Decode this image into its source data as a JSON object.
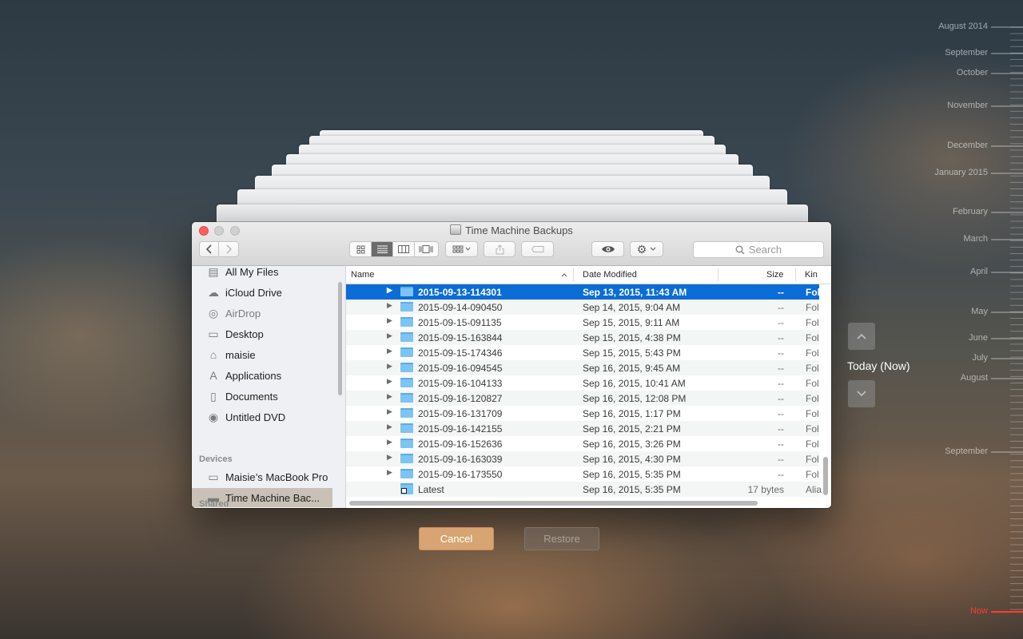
{
  "window": {
    "title": "Time Machine Backups"
  },
  "toolbar": {
    "search_placeholder": "Search",
    "back_icon": "chevron-left-icon",
    "forward_icon": "chevron-right-icon"
  },
  "sidebar": {
    "favorites": [
      {
        "label": "All My Files",
        "icon": "all-files-icon"
      },
      {
        "label": "iCloud Drive",
        "icon": "cloud-icon"
      },
      {
        "label": "AirDrop",
        "icon": "airdrop-icon"
      },
      {
        "label": "Desktop",
        "icon": "desktop-icon"
      },
      {
        "label": "maisie",
        "icon": "home-icon"
      },
      {
        "label": "Applications",
        "icon": "applications-icon"
      },
      {
        "label": "Documents",
        "icon": "documents-icon"
      },
      {
        "label": "Untitled DVD",
        "icon": "dvd-icon"
      }
    ],
    "devices_heading": "Devices",
    "devices": [
      {
        "label": "Maisie’s MacBook Pro",
        "icon": "laptop-icon"
      },
      {
        "label": "Time Machine Bac...",
        "icon": "disk-icon",
        "selected": true
      }
    ],
    "shared_heading": "Shared"
  },
  "columns": {
    "name": "Name",
    "date": "Date Modified",
    "size": "Size",
    "kind": "Kin"
  },
  "rows": [
    {
      "name": "2015-09-13-114301",
      "date": "Sep 13, 2015, 11:43 AM",
      "size": "--",
      "kind": "Fol",
      "selected": true
    },
    {
      "name": "2015-09-14-090450",
      "date": "Sep 14, 2015, 9:04 AM",
      "size": "--",
      "kind": "Fol"
    },
    {
      "name": "2015-09-15-091135",
      "date": "Sep 15, 2015, 9:11 AM",
      "size": "--",
      "kind": "Fol"
    },
    {
      "name": "2015-09-15-163844",
      "date": "Sep 15, 2015, 4:38 PM",
      "size": "--",
      "kind": "Fol"
    },
    {
      "name": "2015-09-15-174346",
      "date": "Sep 15, 2015, 5:43 PM",
      "size": "--",
      "kind": "Fol"
    },
    {
      "name": "2015-09-16-094545",
      "date": "Sep 16, 2015, 9:45 AM",
      "size": "--",
      "kind": "Fol"
    },
    {
      "name": "2015-09-16-104133",
      "date": "Sep 16, 2015, 10:41 AM",
      "size": "--",
      "kind": "Fol"
    },
    {
      "name": "2015-09-16-120827",
      "date": "Sep 16, 2015, 12:08 PM",
      "size": "--",
      "kind": "Fol"
    },
    {
      "name": "2015-09-16-131709",
      "date": "Sep 16, 2015, 1:17 PM",
      "size": "--",
      "kind": "Fol"
    },
    {
      "name": "2015-09-16-142155",
      "date": "Sep 16, 2015, 2:21 PM",
      "size": "--",
      "kind": "Fol"
    },
    {
      "name": "2015-09-16-152636",
      "date": "Sep 16, 2015, 3:26 PM",
      "size": "--",
      "kind": "Fol"
    },
    {
      "name": "2015-09-16-163039",
      "date": "Sep 16, 2015, 4:30 PM",
      "size": "--",
      "kind": "Fol"
    },
    {
      "name": "2015-09-16-173550",
      "date": "Sep 16, 2015, 5:35 PM",
      "size": "--",
      "kind": "Fol"
    },
    {
      "name": "Latest",
      "date": "Sep 16, 2015, 5:35 PM",
      "size": "17 bytes",
      "kind": "Alia",
      "alias": true
    }
  ],
  "actions": {
    "cancel": "Cancel",
    "restore": "Restore"
  },
  "navigation": {
    "current": "Today (Now)"
  },
  "timeline": [
    "August 2014",
    "September",
    "October",
    "November",
    "December",
    "January 2015",
    "February",
    "March",
    "April",
    "May",
    "June",
    "July",
    "August",
    "September",
    "Now"
  ],
  "colors": {
    "selection": "#0b6dd5",
    "cancel_button": "#d7a472",
    "now_marker": "#ff3b30"
  }
}
